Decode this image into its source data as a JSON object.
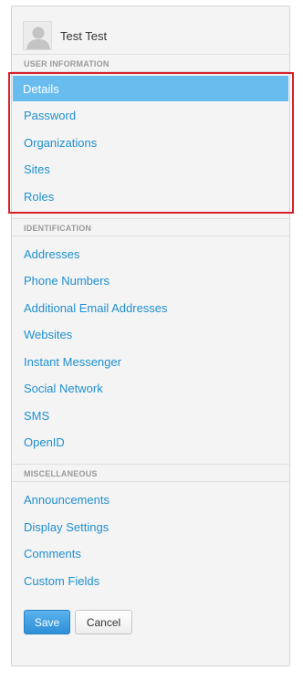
{
  "user": {
    "name": "Test Test"
  },
  "sections": {
    "user_information": {
      "header": "User Information",
      "items": [
        "Details",
        "Password",
        "Organizations",
        "Sites",
        "Roles"
      ],
      "active_item": "Details"
    },
    "identification": {
      "header": "Identification",
      "items": [
        "Addresses",
        "Phone Numbers",
        "Additional Email Addresses",
        "Websites",
        "Instant Messenger",
        "Social Network",
        "SMS",
        "OpenID"
      ]
    },
    "miscellaneous": {
      "header": "Miscellaneous",
      "items": [
        "Announcements",
        "Display Settings",
        "Comments",
        "Custom Fields"
      ]
    }
  },
  "buttons": {
    "save": "Save",
    "cancel": "Cancel"
  },
  "colors": {
    "link": "#1f8fcf",
    "active_background": "#68bdee",
    "highlight_border": "#d7202a",
    "primary_button": "#2e8fd8"
  }
}
